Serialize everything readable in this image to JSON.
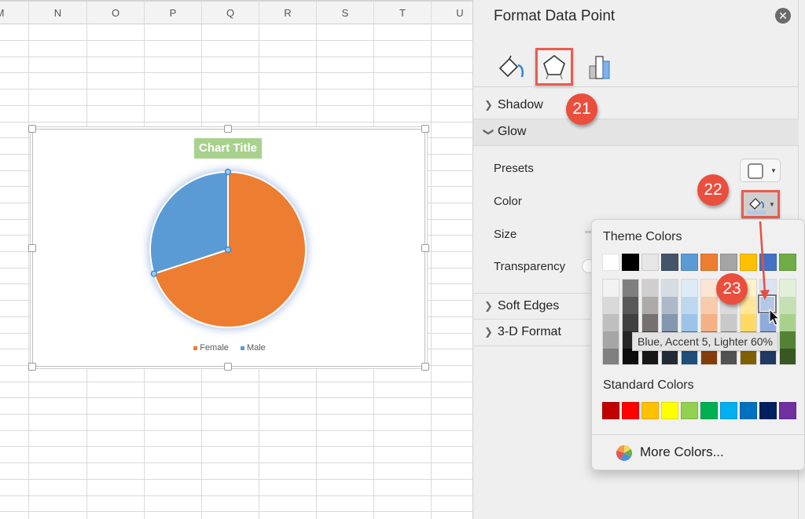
{
  "spreadsheet": {
    "columns": [
      "M",
      "N",
      "O",
      "P",
      "Q",
      "R",
      "S",
      "T",
      "U"
    ]
  },
  "chart": {
    "title": "Chart Title",
    "title_bg": "#a9d18e",
    "glow_color": "#b4c7e7"
  },
  "chart_data": {
    "type": "pie",
    "title": "Chart Title",
    "categories": [
      "Female",
      "Male"
    ],
    "values": [
      70,
      30
    ],
    "colors": [
      "#ed7d31",
      "#5b9bd5"
    ],
    "legend": "bottom",
    "selected_point": "Male"
  },
  "pane": {
    "title": "Format Data Point",
    "close_icon": "close-circle-icon",
    "tabs": [
      {
        "name": "fill-line",
        "icon": "paint-bucket-icon"
      },
      {
        "name": "effects",
        "icon": "pentagon-icon",
        "selected": true
      },
      {
        "name": "series-options",
        "icon": "bar-chart-icon"
      }
    ],
    "sections": {
      "shadow": {
        "label": "Shadow",
        "expanded": false
      },
      "glow": {
        "label": "Glow",
        "expanded": true
      },
      "soft_edges": {
        "label": "Soft Edges",
        "expanded": false
      },
      "three_d": {
        "label": "3-D Format",
        "expanded": false
      }
    },
    "glow_props": {
      "presets": "Presets",
      "color": "Color",
      "size": "Size",
      "transparency": "Transparency"
    }
  },
  "callouts": [
    "21",
    "22",
    "23"
  ],
  "color_popup": {
    "theme_title": "Theme Colors",
    "standard_title": "Standard Colors",
    "more_colors": "More Colors...",
    "theme_colors": [
      "#ffffff",
      "#000000",
      "#e7e6e6",
      "#44546a",
      "#5b9bd5",
      "#ed7d31",
      "#a5a5a5",
      "#ffc000",
      "#4472c4",
      "#70ad47"
    ],
    "shades": [
      [
        "#f2f2f2",
        "#d9d9d9",
        "#bfbfbf",
        "#a6a6a6",
        "#808080"
      ],
      [
        "#7f7f7f",
        "#595959",
        "#404040",
        "#262626",
        "#0d0d0d"
      ],
      [
        "#d0cece",
        "#aeaaaa",
        "#767171",
        "#3b3838",
        "#171616"
      ],
      [
        "#d6dce4",
        "#adb9ca",
        "#8497b0",
        "#333f4f",
        "#222a35"
      ],
      [
        "#deebf7",
        "#bdd7ee",
        "#9dc3e6",
        "#2e75b6",
        "#1f4e79"
      ],
      [
        "#fbe5d6",
        "#f8cbad",
        "#f4b183",
        "#c55a11",
        "#843c0c"
      ],
      [
        "#ededed",
        "#dbdbdb",
        "#c9c9c9",
        "#7b7b7b",
        "#525252"
      ],
      [
        "#fff2cc",
        "#ffe699",
        "#ffd966",
        "#bf9000",
        "#7f6000"
      ],
      [
        "#dae3f3",
        "#b4c7e7",
        "#8faadc",
        "#2f5597",
        "#203864"
      ],
      [
        "#e2f0d9",
        "#c5e0b4",
        "#a9d18e",
        "#548235",
        "#385723"
      ]
    ],
    "standard_colors": [
      "#c00000",
      "#ff0000",
      "#ffc000",
      "#ffff00",
      "#92d050",
      "#00b050",
      "#00b0f0",
      "#0070c0",
      "#002060",
      "#7030a0"
    ],
    "hover_tooltip": "Blue, Accent 5, Lighter 60%"
  }
}
